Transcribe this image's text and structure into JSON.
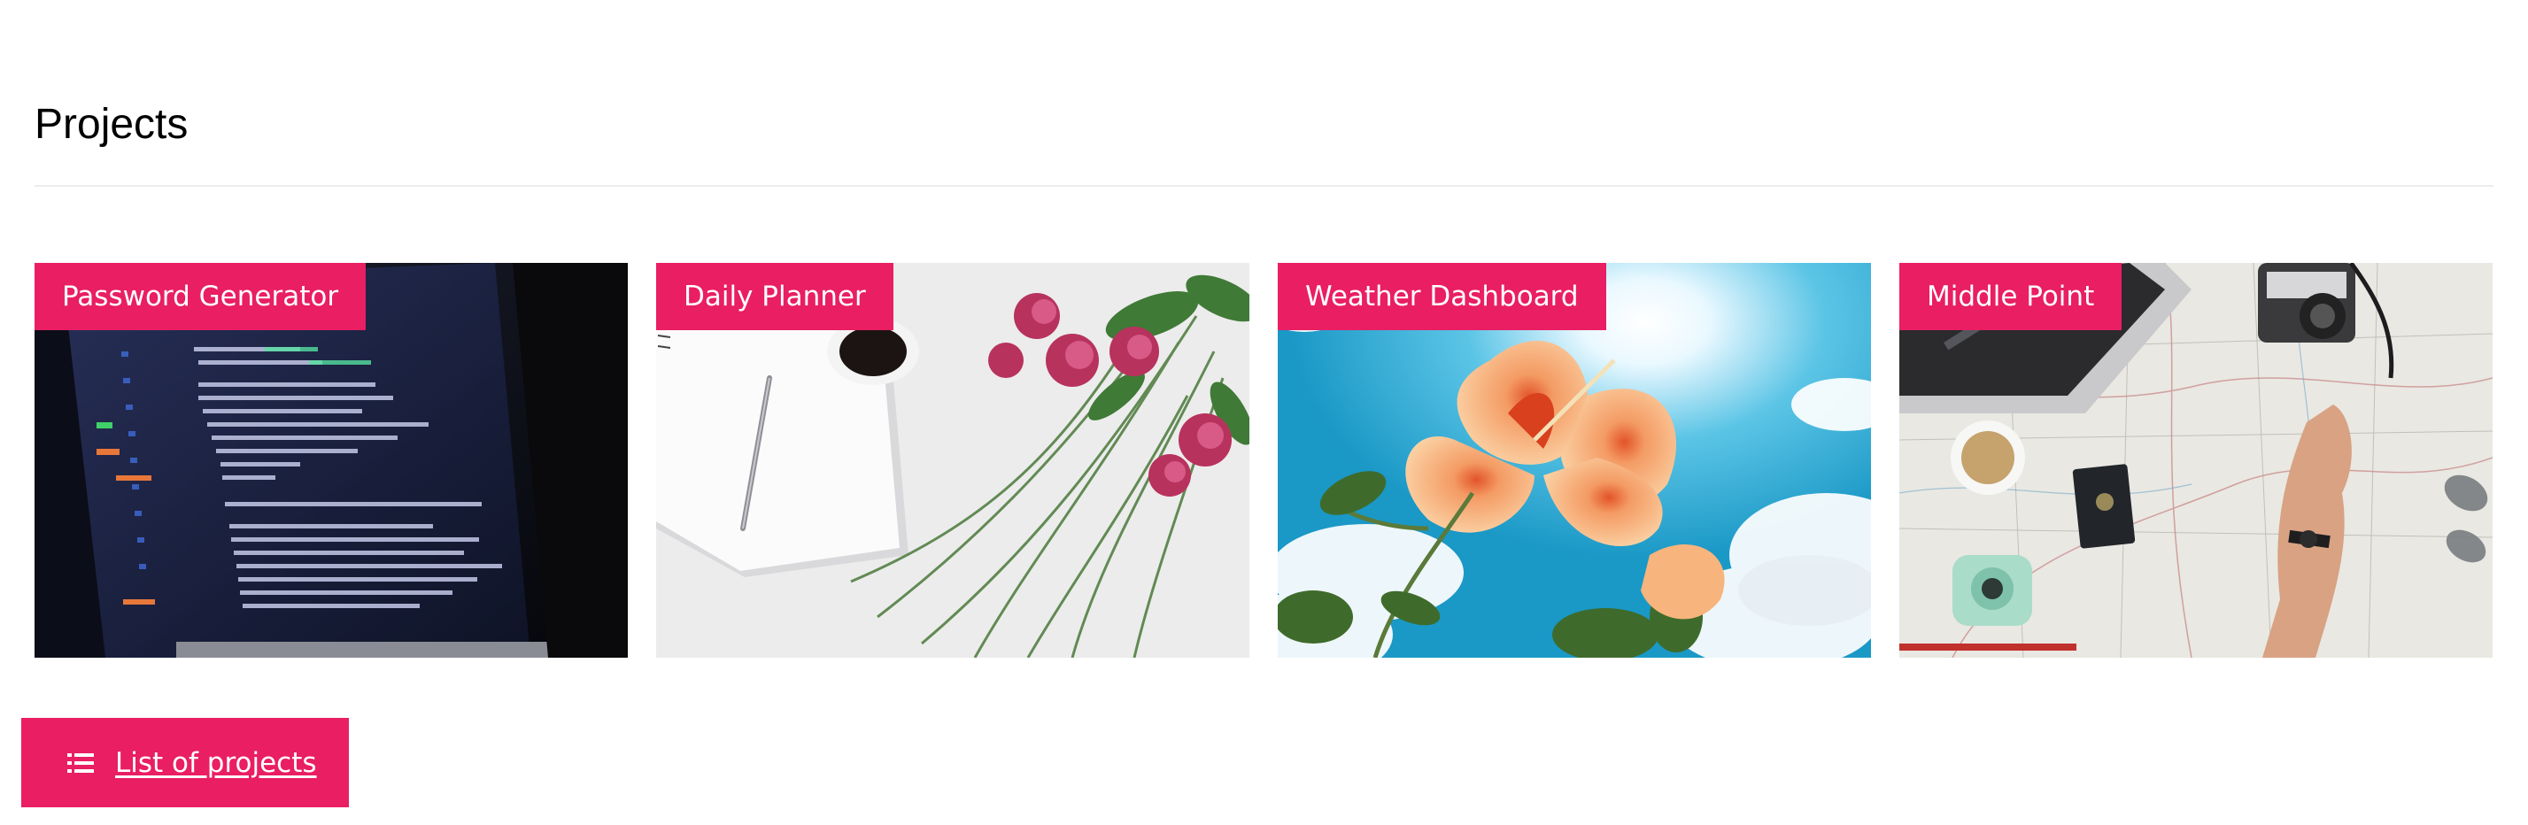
{
  "page": {
    "title": "Projects"
  },
  "projects": [
    {
      "label": "Password Generator",
      "image": "code-on-laptop-photo"
    },
    {
      "label": "Daily Planner",
      "image": "notebook-coffee-roses-photo"
    },
    {
      "label": "Weather Dashboard",
      "image": "hibiscus-sky-photo"
    },
    {
      "label": "Middle Point",
      "image": "travel-map-camera-photo"
    }
  ],
  "footer": {
    "list_button_label": "List of projects",
    "list_button_icon": "list-icon"
  },
  "colors": {
    "accent": "#e91e63",
    "accent_text": "#ffffff",
    "divider": "#ececec"
  }
}
